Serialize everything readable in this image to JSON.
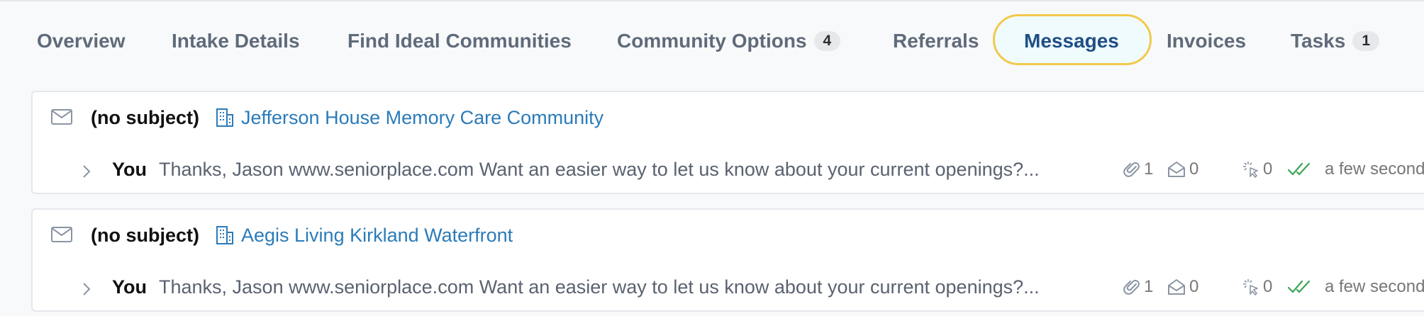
{
  "tabs": [
    {
      "label": "Overview",
      "count": null,
      "active": false
    },
    {
      "label": "Intake Details",
      "count": null,
      "active": false
    },
    {
      "label": "Find Ideal Communities",
      "count": null,
      "active": false
    },
    {
      "label": "Community Options",
      "count": "4",
      "active": false
    },
    {
      "label": "Referrals",
      "count": null,
      "active": false
    },
    {
      "label": "Messages",
      "count": null,
      "active": true
    },
    {
      "label": "Invoices",
      "count": null,
      "active": false
    },
    {
      "label": "Tasks",
      "count": "1",
      "active": false
    }
  ],
  "messages": [
    {
      "subject": "(no subject)",
      "community": "Jefferson House Memory Care Community",
      "sender": "You",
      "preview": "Thanks, Jason www.seniorplace.com Want an easier way to let us know about your current openings?...",
      "attachments": "1",
      "opens": "0",
      "clicks": "0",
      "timestamp": "a few seconds ag"
    },
    {
      "subject": "(no subject)",
      "community": "Aegis Living Kirkland Waterfront",
      "sender": "You",
      "preview": "Thanks, Jason www.seniorplace.com Want an easier way to let us know about your current openings?...",
      "attachments": "1",
      "opens": "0",
      "clicks": "0",
      "timestamp": "a few seconds ag"
    }
  ],
  "colors": {
    "active_tab_text": "#1f4e85",
    "active_tab_border": "#f2c94c",
    "link": "#2b7bb9",
    "delivered_check": "#3aa655"
  },
  "icons": {
    "message": "envelope-icon",
    "community": "building-icon",
    "expand": "chevron-right-icon",
    "attachment": "paperclip-icon",
    "opens": "envelope-open-icon",
    "clicks": "cursor-click-icon",
    "status": "double-check-icon"
  }
}
